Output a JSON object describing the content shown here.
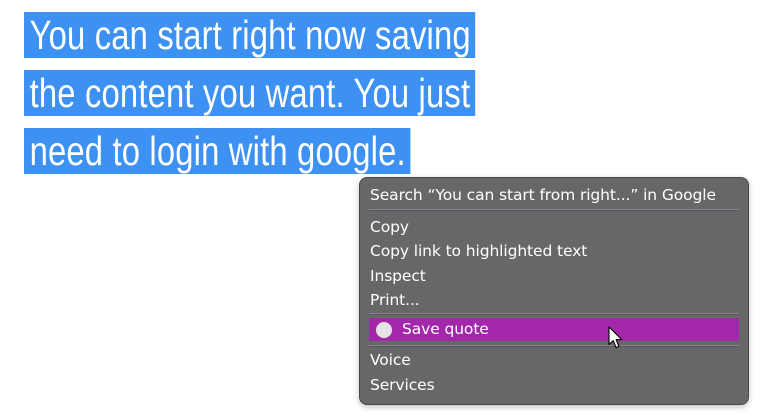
{
  "headline": {
    "lines": [
      "You can start right now saving",
      "the content you want. You just",
      "need to login with google."
    ]
  },
  "context_menu": {
    "search_label": "Search “You can start from right...” in Google",
    "copy_label": "Copy",
    "copy_link_label": "Copy link to highlighted text",
    "inspect_label": "Inspect",
    "print_label": "Print...",
    "save_quote_label": "Save quote",
    "voice_label": "Voice",
    "services_label": "Services",
    "highlight_color": "#a228a9",
    "background_color": "#676669"
  },
  "selection_color": "#3d91f2",
  "icons": {
    "save_quote": "circle-icon",
    "pointer": "mouse-pointer-icon"
  }
}
